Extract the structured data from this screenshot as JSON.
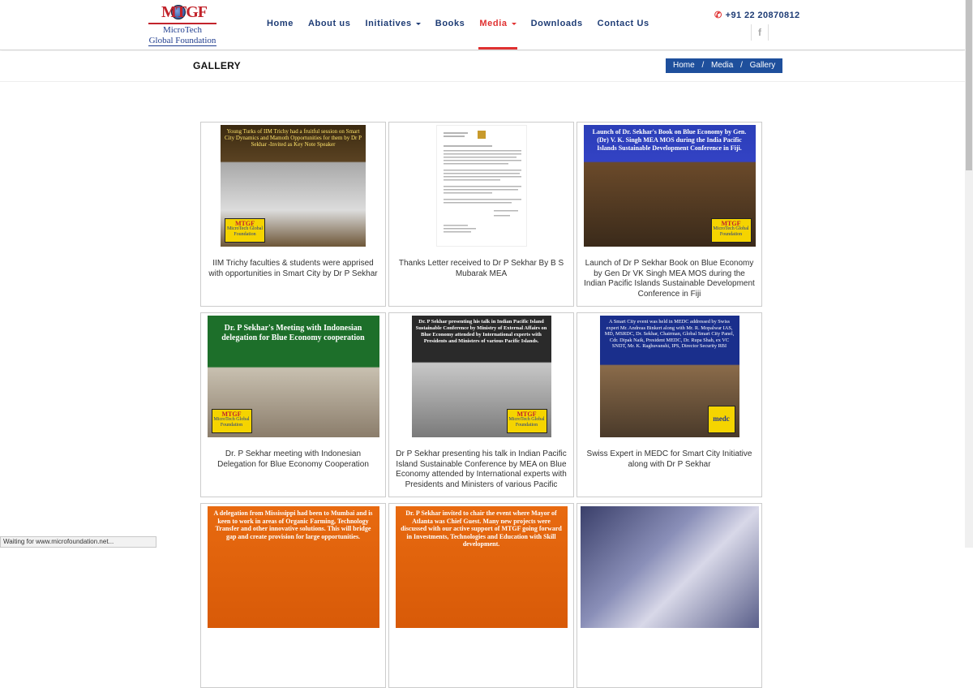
{
  "header": {
    "logo": {
      "letters": "MTGF",
      "line1": "MicroTech",
      "line2": "Global Foundation"
    },
    "nav": [
      {
        "label": "Home",
        "dropdown": false,
        "active": false
      },
      {
        "label": "About us",
        "dropdown": false,
        "active": false
      },
      {
        "label": "Initiatives",
        "dropdown": true,
        "active": false
      },
      {
        "label": "Books",
        "dropdown": false,
        "active": false
      },
      {
        "label": "Media",
        "dropdown": true,
        "active": true
      },
      {
        "label": "Downloads",
        "dropdown": false,
        "active": false
      },
      {
        "label": "Contact Us",
        "dropdown": false,
        "active": false
      }
    ],
    "phone": "+91 22 20870812",
    "social_icon": "facebook-icon",
    "social_glyph": "f"
  },
  "titlebar": {
    "title": "GALLERY",
    "breadcrumb": [
      "Home",
      "Media",
      "Gallery"
    ],
    "separator": "/"
  },
  "gallery": {
    "items": [
      {
        "caption": "IIM Trichy faculties & students were apprised with opportunities in Smart City by Dr P Sekhar",
        "thumb_text": "Young Turks of IIM Trichy had a fruitful session on Smart City Dynamics and Mamoth Opportunities for them by Dr P Sekhar -Invited as Key Note Speaker",
        "theme": "dark"
      },
      {
        "caption": "Thanks Letter received to Dr P Sekhar By B S Mubarak MEA",
        "thumb_text": "",
        "theme": "letter"
      },
      {
        "caption": "Launch of Dr P Sekhar Book on Blue Economy by Gen Dr VK Singh MEA MOS during the Indian Pacific Islands Sustainable Development Conference in Fiji",
        "thumb_text": "Launch of Dr. Sekhar's Book on Blue Economy by Gen.(Dr) V. K. Singh MEA MOS during the India Pacific Islands Sustainable Development Conference in Fiji.",
        "theme": "blue"
      },
      {
        "caption": "Dr. P Sekhar meeting with Indonesian Delegation for Blue Economy Cooperation",
        "thumb_text": "Dr. P Sekhar's Meeting with Indonesian delegation for Blue Economy cooperation",
        "theme": "green"
      },
      {
        "caption": "Dr P Sekhar presenting his talk in Indian Pacific Island Sustainable Conference by MEA on Blue Economy attended by International experts with Presidents and Ministers of various Pacific Islands",
        "thumb_text": "Dr. P Sekhar presenting his talk in Indian Pacific Island Sustainable Conference by Ministry of External Affairs on Blue Economy attended by International experts with Presidents and Ministers of various Pacific Islands.",
        "theme": "dark2"
      },
      {
        "caption": "Swiss Expert in MEDC for Smart City Initiative along with Dr P Sekhar",
        "thumb_text": "A Smart City event was held in MEDC addressed by Swiss expert Mr. Andreas Binkert along with Mr. R. Mopalwar IAS, MD, MSRDC, Dr. Sekhar, Chairman, Global Smart City Panel, Cdr. Dipak Naik, President MEDC, Dr. Rupa Shah, ex VC SNDT, Mr. K. Raghuvanshi, IPS, Director Security RBI",
        "theme": "navy"
      },
      {
        "caption": "",
        "thumb_text": "A delegation from Mississippi had been to Mumbai and is keen to work in areas of Organic Farming, Technology Transfer and other innovative solutions. This will bridge gap and create provision for large opportunities.",
        "theme": "orange"
      },
      {
        "caption": "",
        "thumb_text": "Dr. P Sekhar invited to chair the event where Mayor of Atlanta was Chief Guest. Many new projects were discussed with our active support of MTGF going forward in Investments, Technologies and Education with Skill development.",
        "theme": "orange2"
      },
      {
        "caption": "",
        "thumb_text": "",
        "theme": "photo"
      }
    ]
  },
  "status": "Waiting for www.microfoundation.net...",
  "colors": {
    "nav_text": "#1e3c75",
    "active": "#e03131",
    "breadcrumb_bg": "#1e4f9c"
  }
}
